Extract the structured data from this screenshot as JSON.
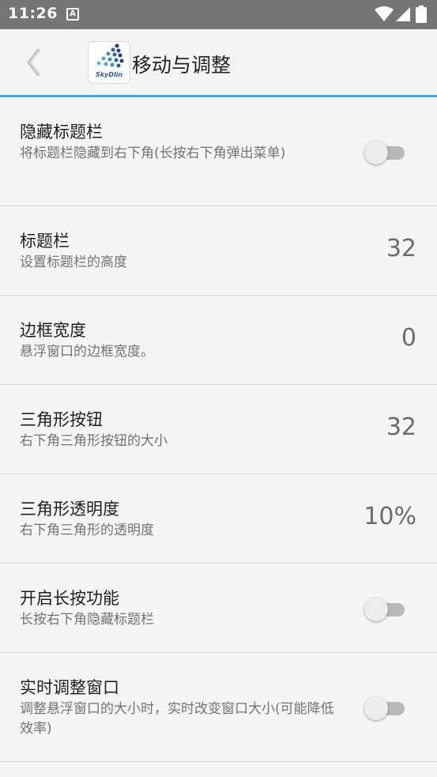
{
  "status_bar": {
    "time": "11:26",
    "notification_icon": "A"
  },
  "app_bar": {
    "title": "移动与调整",
    "logo_text": "SkyDlin",
    "back_icon": "chevron-left-icon"
  },
  "colors": {
    "accent": "#4aa8d8",
    "status_bar": "#757575"
  },
  "settings": [
    {
      "title": "隐藏标题栏",
      "summary": "将标题栏隐藏到右下角(长按右下角弹出菜单)",
      "toggle_on": false
    },
    {
      "title": "标题栏",
      "summary": "设置标题栏的高度",
      "value": "32"
    },
    {
      "title": "边框宽度",
      "summary": "悬浮窗口的边框宽度。",
      "value": "0"
    },
    {
      "title": "三角形按钮",
      "summary": "右下角三角形按钮的大小",
      "value": "32"
    },
    {
      "title": "三角形透明度",
      "summary": "右下角三角形的透明度",
      "value": "10%"
    },
    {
      "title": "开启长按功能",
      "summary": "长按右下角隐藏标题栏",
      "toggle_on": false
    },
    {
      "title": "实时调整窗口",
      "summary": "调整悬浮窗口的大小时，实时改变窗口大小(可能降低效率)",
      "toggle_on": false
    }
  ]
}
